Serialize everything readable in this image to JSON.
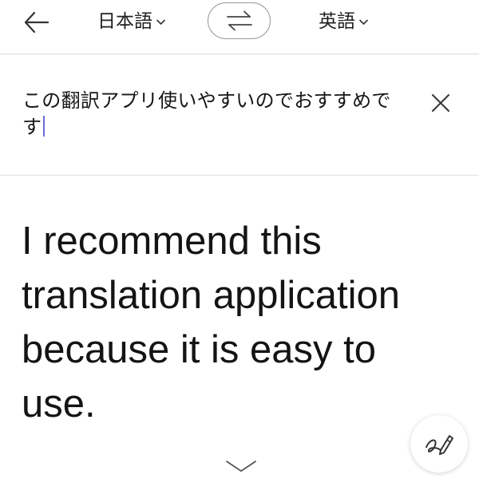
{
  "header": {
    "source_language": "日本語",
    "target_language": "英語",
    "icons": {
      "back": "arrow-left-icon",
      "swap": "swap-arrows-icon",
      "dropdown": "chevron-down-icon"
    }
  },
  "input": {
    "text": "この翻訳アプリ使いやすいのでおすすめです",
    "clear_icon": "close-icon"
  },
  "output": {
    "text": "I recommend this translation application because it is easy to use."
  },
  "actions": {
    "handwriting_icon": "pen-icon",
    "expand_icon": "chevron-down-icon"
  }
}
